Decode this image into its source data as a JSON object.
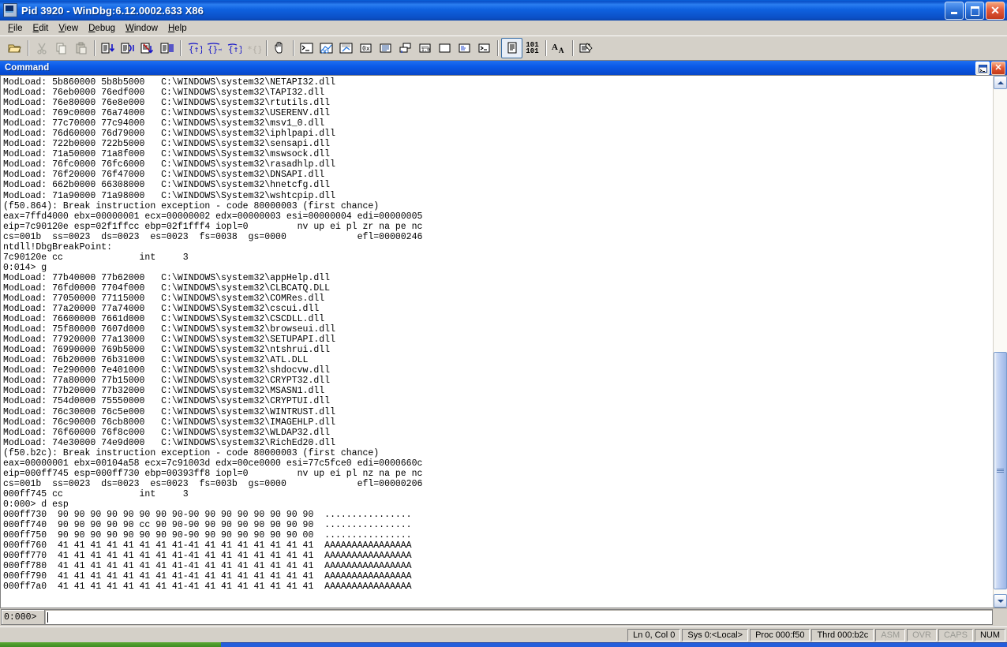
{
  "window": {
    "title": "Pid 3920 - WinDbg:6.12.0002.633 X86",
    "icon": "windbg-icon",
    "minimize_label": "Minimize",
    "maximize_label": "Restore",
    "close_label": "Close"
  },
  "menu": {
    "items": [
      {
        "label": "File",
        "accel": "F"
      },
      {
        "label": "Edit",
        "accel": "E"
      },
      {
        "label": "View",
        "accel": "V"
      },
      {
        "label": "Debug",
        "accel": "D"
      },
      {
        "label": "Window",
        "accel": "W"
      },
      {
        "label": "Help",
        "accel": "H"
      }
    ]
  },
  "toolbar": {
    "buttons": [
      {
        "name": "open-folder-icon",
        "label": "Open Source File"
      },
      {
        "name": "cut-icon",
        "label": "Cut"
      },
      {
        "name": "copy-icon",
        "label": "Copy"
      },
      {
        "name": "paste-icon",
        "label": "Paste"
      },
      {
        "name": "step-into-icon",
        "label": "Step Into"
      },
      {
        "name": "step-over-icon",
        "label": "Step Over"
      },
      {
        "name": "run-to-cursor-icon",
        "label": "Run To Cursor"
      },
      {
        "name": "step-out-icon",
        "label": "Step Out"
      },
      {
        "name": "trace-into-icon",
        "label": "Trace Into"
      },
      {
        "name": "go-unhandled-icon",
        "label": "Go Unhandled Exception"
      },
      {
        "name": "go-handled-icon",
        "label": "Go Handled Exception"
      },
      {
        "name": "trace-monitor-icon",
        "label": "Trace And Watch Data"
      },
      {
        "name": "break-hand-icon",
        "label": "Break"
      },
      {
        "name": "command-window-icon",
        "label": "Command"
      },
      {
        "name": "watch-window-icon",
        "label": "Watch"
      },
      {
        "name": "locals-window-icon",
        "label": "Locals"
      },
      {
        "name": "registers-window-icon",
        "label": "Registers"
      },
      {
        "name": "memory-window-icon",
        "label": "Memory"
      },
      {
        "name": "calls-window-icon",
        "label": "Call Stack"
      },
      {
        "name": "disassembly-window-icon",
        "label": "Disassembly"
      },
      {
        "name": "scratch-pad-icon",
        "label": "Scratch Pad"
      },
      {
        "name": "processes-threads-icon",
        "label": "Processes and Threads"
      },
      {
        "name": "command-browser-icon",
        "label": "Command Browser"
      },
      {
        "name": "source-mode-icon",
        "label": "Source Mode"
      },
      {
        "name": "numeric-base-icon",
        "label": "Numeric Base"
      },
      {
        "name": "font-icon",
        "label": "Font"
      },
      {
        "name": "options-icon",
        "label": "Options"
      }
    ]
  },
  "command_window": {
    "title": "Command",
    "restore_label": "Restore",
    "close_label": "Close",
    "prompt_label": "0:000>",
    "prompt_value": "",
    "scroll": {
      "up_label": "Scroll Up",
      "down_label": "Scroll Down"
    },
    "lines": [
      "ModLoad: 5b860000 5b8b5000   C:\\WINDOWS\\system32\\NETAPI32.dll",
      "ModLoad: 76eb0000 76edf000   C:\\WINDOWS\\system32\\TAPI32.dll",
      "ModLoad: 76e80000 76e8e000   C:\\WINDOWS\\system32\\rtutils.dll",
      "ModLoad: 769c0000 76a74000   C:\\WINDOWS\\system32\\USERENV.dll",
      "ModLoad: 77c70000 77c94000   C:\\WINDOWS\\system32\\msv1_0.dll",
      "ModLoad: 76d60000 76d79000   C:\\WINDOWS\\system32\\iphlpapi.dll",
      "ModLoad: 722b0000 722b5000   C:\\WINDOWS\\system32\\sensapi.dll",
      "ModLoad: 71a50000 71a8f000   C:\\WINDOWS\\System32\\mswsock.dll",
      "ModLoad: 76fc0000 76fc6000   C:\\WINDOWS\\system32\\rasadhlp.dll",
      "ModLoad: 76f20000 76f47000   C:\\WINDOWS\\system32\\DNSAPI.dll",
      "ModLoad: 662b0000 66308000   C:\\WINDOWS\\system32\\hnetcfg.dll",
      "ModLoad: 71a90000 71a98000   C:\\WINDOWS\\System32\\wshtcpip.dll",
      "(f50.864): Break instruction exception - code 80000003 (first chance)",
      "eax=7ffd4000 ebx=00000001 ecx=00000002 edx=00000003 esi=00000004 edi=00000005",
      "eip=7c90120e esp=02f1ffcc ebp=02f1fff4 iopl=0         nv up ei pl zr na pe nc",
      "cs=001b  ss=0023  ds=0023  es=0023  fs=0038  gs=0000             efl=00000246",
      "ntdll!DbgBreakPoint:",
      "7c90120e cc              int     3",
      "0:014> g",
      "ModLoad: 77b40000 77b62000   C:\\WINDOWS\\system32\\appHelp.dll",
      "ModLoad: 76fd0000 7704f000   C:\\WINDOWS\\system32\\CLBCATQ.DLL",
      "ModLoad: 77050000 77115000   C:\\WINDOWS\\system32\\COMRes.dll",
      "ModLoad: 77a20000 77a74000   C:\\WINDOWS\\System32\\cscui.dll",
      "ModLoad: 76600000 7661d000   C:\\WINDOWS\\System32\\CSCDLL.dll",
      "ModLoad: 75f80000 7607d000   C:\\WINDOWS\\system32\\browseui.dll",
      "ModLoad: 77920000 77a13000   C:\\WINDOWS\\system32\\SETUPAPI.dll",
      "ModLoad: 76990000 769b5000   C:\\WINDOWS\\system32\\ntshrui.dll",
      "ModLoad: 76b20000 76b31000   C:\\WINDOWS\\system32\\ATL.DLL",
      "ModLoad: 7e290000 7e401000   C:\\WINDOWS\\system32\\shdocvw.dll",
      "ModLoad: 77a80000 77b15000   C:\\WINDOWS\\system32\\CRYPT32.dll",
      "ModLoad: 77b20000 77b32000   C:\\WINDOWS\\system32\\MSASN1.dll",
      "ModLoad: 754d0000 75550000   C:\\WINDOWS\\system32\\CRYPTUI.dll",
      "ModLoad: 76c30000 76c5e000   C:\\WINDOWS\\system32\\WINTRUST.dll",
      "ModLoad: 76c90000 76cb8000   C:\\WINDOWS\\system32\\IMAGEHLP.dll",
      "ModLoad: 76f60000 76f8c000   C:\\WINDOWS\\system32\\WLDAP32.dll",
      "ModLoad: 74e30000 74e9d000   C:\\WINDOWS\\system32\\RichEd20.dll",
      "(f50.b2c): Break instruction exception - code 80000003 (first chance)",
      "eax=00000001 ebx=00104a58 ecx=7c91003d edx=00ce0000 esi=77c5fce0 edi=0000660c",
      "eip=000ff745 esp=000ff730 ebp=00393ff8 iopl=0         nv up ei pl nz na pe nc",
      "cs=001b  ss=0023  ds=0023  es=0023  fs=003b  gs=0000             efl=00000206",
      "000ff745 cc              int     3",
      "0:000> d esp",
      "000ff730  90 90 90 90 90 90 90 90-90 90 90 90 90 90 90 90  ................",
      "000ff740  90 90 90 90 90 cc 90 90-90 90 90 90 90 90 90 90  ................",
      "000ff750  90 90 90 90 90 90 90 90-90 90 90 90 90 90 90 00  ................",
      "000ff760  41 41 41 41 41 41 41 41-41 41 41 41 41 41 41 41  AAAAAAAAAAAAAAAA",
      "000ff770  41 41 41 41 41 41 41 41-41 41 41 41 41 41 41 41  AAAAAAAAAAAAAAAA",
      "000ff780  41 41 41 41 41 41 41 41-41 41 41 41 41 41 41 41  AAAAAAAAAAAAAAAA",
      "000ff790  41 41 41 41 41 41 41 41-41 41 41 41 41 41 41 41  AAAAAAAAAAAAAAAA",
      "000ff7a0  41 41 41 41 41 41 41 41-41 41 41 41 41 41 41 41  AAAAAAAAAAAAAAAA"
    ]
  },
  "status_bar": {
    "panels": [
      {
        "label": "Ln 0, Col 0",
        "dim": false,
        "name": "status-line-col"
      },
      {
        "label": "Sys 0:<Local>",
        "dim": false,
        "name": "status-system"
      },
      {
        "label": "Proc 000:f50",
        "dim": false,
        "name": "status-process"
      },
      {
        "label": "Thrd 000:b2c",
        "dim": false,
        "name": "status-thread"
      },
      {
        "label": "ASM",
        "dim": true,
        "name": "status-asm"
      },
      {
        "label": "OVR",
        "dim": true,
        "name": "status-ovr"
      },
      {
        "label": "CAPS",
        "dim": true,
        "name": "status-caps"
      },
      {
        "label": "NUM",
        "dim": false,
        "name": "status-num"
      }
    ]
  },
  "colors": {
    "title_blue": "#0a50c8",
    "chrome": "#d4d0c8",
    "text_bg": "#ffffff",
    "text_fg": "#000000",
    "taskbar_blue": "#245edb",
    "start_green": "#3d8b22"
  }
}
